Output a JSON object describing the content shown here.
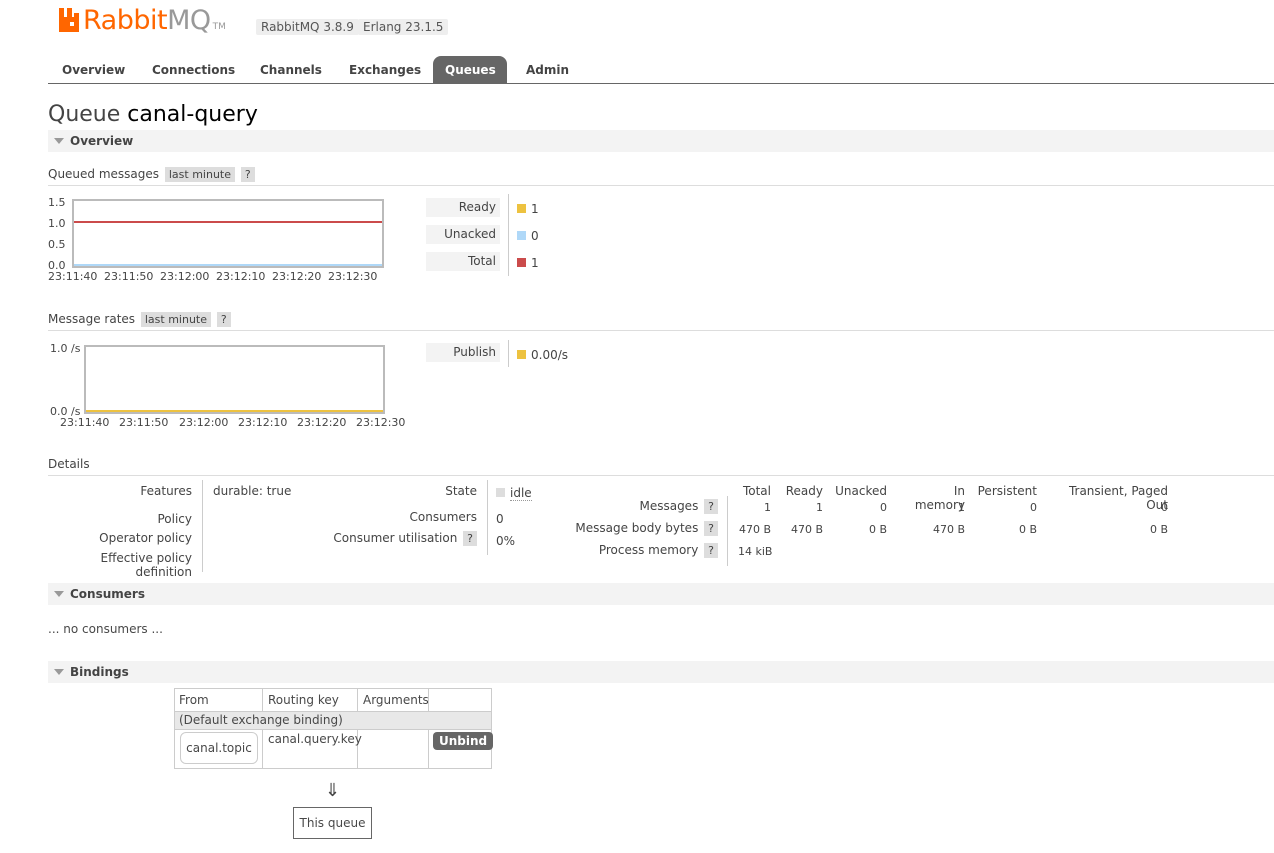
{
  "header": {
    "logo_brand": "Rabbit",
    "logo_mq": "MQ",
    "logo_tm": "TM",
    "version": "RabbitMQ 3.8.9",
    "erlang": "Erlang 23.1.5"
  },
  "tabs": [
    "Overview",
    "Connections",
    "Channels",
    "Exchanges",
    "Queues",
    "Admin"
  ],
  "active_tab": "Queues",
  "page": {
    "title_prefix": "Queue",
    "queue_name": "canal-query"
  },
  "overview": {
    "section_label": "Overview",
    "queued_label": "Queued messages",
    "queued_range": "last minute",
    "help": "?",
    "queued_chart": {
      "y_ticks": [
        "1.5",
        "1.0",
        "0.5",
        "0.0"
      ],
      "x_ticks": [
        "23:11:40",
        "23:11:50",
        "23:12:00",
        "23:12:10",
        "23:12:20",
        "23:12:30"
      ]
    },
    "queued_legend": [
      {
        "label": "Ready",
        "value": "1",
        "color": "#edc240"
      },
      {
        "label": "Unacked",
        "value": "0",
        "color": "#afd8f8"
      },
      {
        "label": "Total",
        "value": "1",
        "color": "#cb4b4b"
      }
    ],
    "rates_label": "Message rates",
    "rates_range": "last minute",
    "rates_chart": {
      "y_ticks": [
        "1.0 /s",
        "0.0 /s"
      ],
      "x_ticks": [
        "23:11:40",
        "23:11:50",
        "23:12:00",
        "23:12:10",
        "23:12:20",
        "23:12:30"
      ]
    },
    "rates_legend": [
      {
        "label": "Publish",
        "value": "0.00/s",
        "color": "#edc240"
      }
    ]
  },
  "details": {
    "label": "Details",
    "features_label": "Features",
    "features_key": "durable:",
    "features_val": "true",
    "policy_label": "Policy",
    "operator_policy_label": "Operator policy",
    "effective_policy_label": "Effective policy definition",
    "state_label": "State",
    "state_val": "idle",
    "consumers_label": "Consumers",
    "consumers_val": "0",
    "consumer_util_label": "Consumer utilisation",
    "consumer_util_val": "0%",
    "table_headers": [
      "Total",
      "Ready",
      "Unacked",
      "In memory",
      "Persistent",
      "Transient, Paged Out"
    ],
    "rows": [
      {
        "label": "Messages",
        "values": [
          "1",
          "1",
          "0",
          "1",
          "0",
          "0"
        ]
      },
      {
        "label": "Message body bytes",
        "values": [
          "470 B",
          "470 B",
          "0 B",
          "470 B",
          "0 B",
          "0 B"
        ]
      },
      {
        "label": "Process memory",
        "values": [
          "14 kiB"
        ]
      }
    ]
  },
  "consumers": {
    "section_label": "Consumers",
    "empty": "... no consumers ..."
  },
  "bindings": {
    "section_label": "Bindings",
    "headers": [
      "From",
      "Routing key",
      "Arguments"
    ],
    "default_row": "(Default exchange binding)",
    "row": {
      "from": "canal.topic",
      "routing_key": "canal.query.key",
      "action": "Unbind"
    },
    "arrow": "⇓",
    "this_queue": "This queue"
  }
}
